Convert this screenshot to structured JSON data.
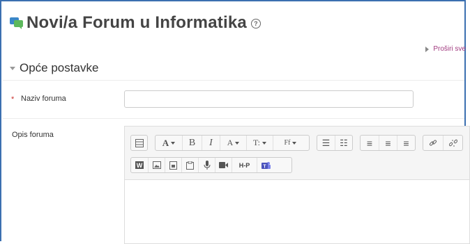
{
  "page": {
    "title": "Novi/a Forum u Informatika",
    "help": "?"
  },
  "expand_all": "Proširi sve",
  "section": {
    "title": "Opće postavke"
  },
  "fields": {
    "name": {
      "required_marker": "*",
      "label": "Naziv foruma",
      "value": ""
    },
    "description": {
      "label": "Opis foruma"
    }
  },
  "toolbar": {
    "row1": [
      {
        "name": "toolbar-toggle-icon",
        "text": ""
      },
      {
        "name": "font-family-icon",
        "text": "A"
      },
      {
        "name": "bold-icon",
        "text": "B"
      },
      {
        "name": "italic-icon",
        "text": "I"
      },
      {
        "name": "font-color-icon",
        "text": "A"
      },
      {
        "name": "font-size-icon",
        "text": "T:"
      },
      {
        "name": "paragraph-style-icon",
        "text": "Ff"
      },
      {
        "name": "bullet-list-icon",
        "text": "☰"
      },
      {
        "name": "numbered-list-icon",
        "text": "☷"
      },
      {
        "name": "align-left-icon",
        "text": "≡"
      },
      {
        "name": "align-center-icon",
        "text": "≡"
      },
      {
        "name": "align-right-icon",
        "text": "≡"
      },
      {
        "name": "link-icon",
        "text": "🔗"
      },
      {
        "name": "unlink-icon",
        "text": "⛓"
      }
    ],
    "row2": [
      {
        "name": "wiris-icon",
        "text": "W"
      },
      {
        "name": "image-icon",
        "text": "▲"
      },
      {
        "name": "media-icon",
        "text": "▣"
      },
      {
        "name": "file-manager-icon",
        "text": "⎘"
      },
      {
        "name": "record-audio-icon",
        "text": "🎙"
      },
      {
        "name": "record-video-icon",
        "text": "■"
      },
      {
        "name": "h5p-icon",
        "text": "H-P"
      },
      {
        "name": "teams-icon",
        "text": "T"
      }
    ]
  },
  "colors": {
    "accent": "#3b6fb0",
    "link": "#a0387e",
    "required": "#c9302c",
    "forum_icon_green": "#5cb85c",
    "forum_icon_blue": "#3a87c8"
  }
}
